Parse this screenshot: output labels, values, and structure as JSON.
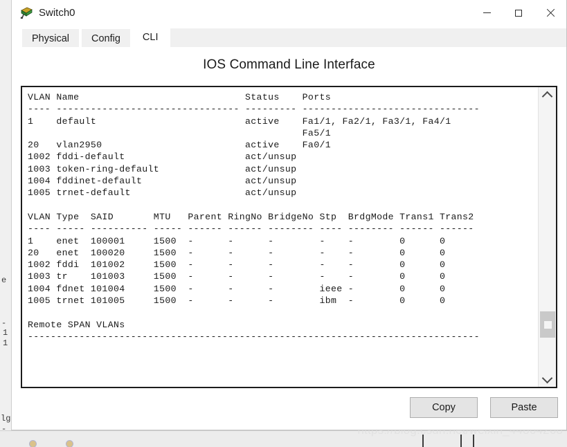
{
  "window": {
    "title": "Switch0",
    "icon": "switch-device-icon",
    "controls": {
      "minimize": "—",
      "maximize": "□",
      "close": "✕"
    }
  },
  "tabs": [
    {
      "label": "Physical",
      "active": false
    },
    {
      "label": "Config",
      "active": false
    },
    {
      "label": "CLI",
      "active": true
    }
  ],
  "main": {
    "heading": "IOS Command Line Interface"
  },
  "terminal": {
    "content": "VLAN Name                             Status    Ports\n---- -------------------------------- --------- -------------------------------\n1    default                          active    Fa1/1, Fa2/1, Fa3/1, Fa4/1\n                                                Fa5/1\n20   vlan2950                         active    Fa0/1\n1002 fddi-default                     act/unsup\n1003 token-ring-default               act/unsup\n1004 fddinet-default                  act/unsup\n1005 trnet-default                    act/unsup\n\nVLAN Type  SAID       MTU   Parent RingNo BridgeNo Stp  BrdgMode Trans1 Trans2\n---- ----- ---------- ----- ------ ------ -------- ---- -------- ------ ------\n1    enet  100001     1500  -      -      -        -    -        0      0\n20   enet  100020     1500  -      -      -        -    -        0      0\n1002 fddi  101002     1500  -      -      -        -    -        0      0\n1003 tr    101003     1500  -      -      -        -    -        0      0\n1004 fdnet 101004     1500  -      -      -        ieee -        0      0\n1005 trnet 101005     1500  -      -      -        ibm  -        0      0\n\nRemote SPAN VLANs\n-------------------------------------------------------------------------------"
  },
  "scrollbar": {
    "up_arrow": "scroll-up",
    "down_arrow": "scroll-down",
    "thumb_position_percent": 86
  },
  "footer": {
    "copy_label": "Copy",
    "paste_label": "Paste"
  },
  "watermark": {
    "text": "https://blog.csdn.net/weixin_44864268"
  },
  "background": {
    "fragment_1": "e",
    "fragment_2": "-",
    "fragment_3": "1",
    "fragment_4": "1",
    "fragment_5": "lg",
    "fragment_6": "-"
  }
}
